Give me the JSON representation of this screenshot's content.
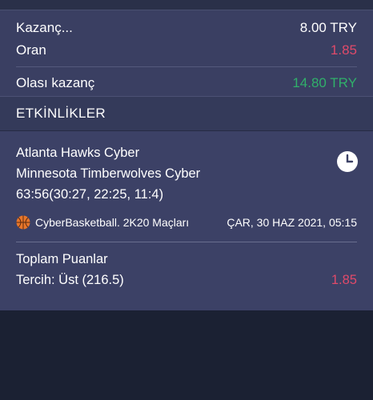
{
  "summary": {
    "stake_label": "Kazanç...",
    "stake_value": "8.00 TRY",
    "odds_label": "Oran",
    "odds_value": "1.85",
    "potential_label": "Olası kazanç",
    "potential_value": "14.80 TRY"
  },
  "events_header": "ETKİNLİKLER",
  "event": {
    "team1": "Atlanta Hawks Cyber",
    "team2": "Minnesota Timberwolves Cyber",
    "score": "63:56(30:27, 22:25, 11:4)",
    "league": "CyberBasketball. 2K20 Maçları",
    "datetime": "ÇAR, 30 HAZ 2021, 05:15",
    "market": "Toplam Puanlar",
    "pick": "Tercih: Üst (216.5)",
    "pick_odds": "1.85"
  },
  "colors": {
    "accent_red": "#e04a6a",
    "accent_green": "#30b06a",
    "icon_names": [
      "clock-icon",
      "basketball-icon"
    ]
  }
}
